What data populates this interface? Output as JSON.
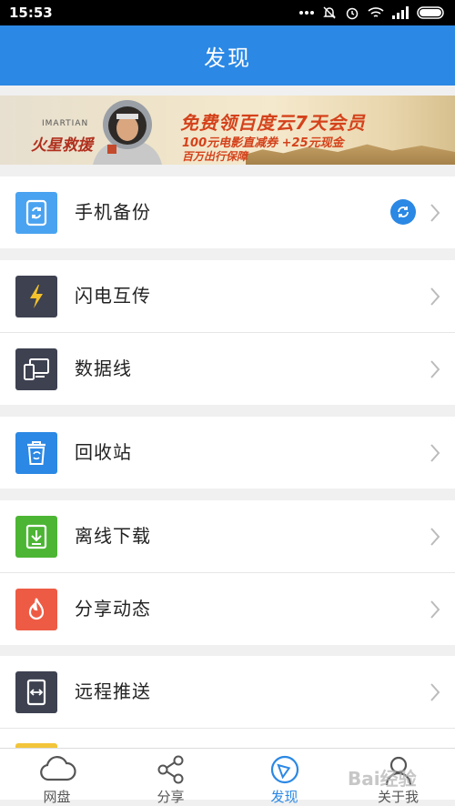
{
  "status_bar": {
    "time": "15:53"
  },
  "header": {
    "title": "发现"
  },
  "banner": {
    "subtitle_en": "IMARTIAN",
    "film_title": "火星救援",
    "promo_line1": "免费领百度云7天会员",
    "promo_line2": "100元电影直减券 +25元现金",
    "promo_line3": "百万出行保障"
  },
  "menu": [
    {
      "id": "backup",
      "label": "手机备份",
      "icon": "phone-sync-icon",
      "color": "#4aa3f0"
    },
    {
      "id": "flash",
      "label": "闪电互传",
      "icon": "lightning-icon",
      "color": "#3d4150"
    },
    {
      "id": "cable",
      "label": "数据线",
      "icon": "devices-icon",
      "color": "#3d4150"
    },
    {
      "id": "recycle",
      "label": "回收站",
      "icon": "recycle-bin-icon",
      "color": "#2b88e4"
    },
    {
      "id": "offline",
      "label": "离线下载",
      "icon": "download-icon",
      "color": "#4cb534"
    },
    {
      "id": "share",
      "label": "分享动态",
      "icon": "flame-icon",
      "color": "#ee5b44"
    },
    {
      "id": "push",
      "label": "远程推送",
      "icon": "remote-push-icon",
      "color": "#3d4150"
    }
  ],
  "tabs": [
    {
      "label": "网盘",
      "icon": "cloud-icon"
    },
    {
      "label": "分享",
      "icon": "share-icon"
    },
    {
      "label": "发现",
      "icon": "compass-icon",
      "active": true
    },
    {
      "label": "关于我",
      "icon": "user-icon"
    }
  ],
  "colors": {
    "accent": "#2b88e4",
    "background": "#f0f0f0"
  },
  "watermark": "Bai经验"
}
